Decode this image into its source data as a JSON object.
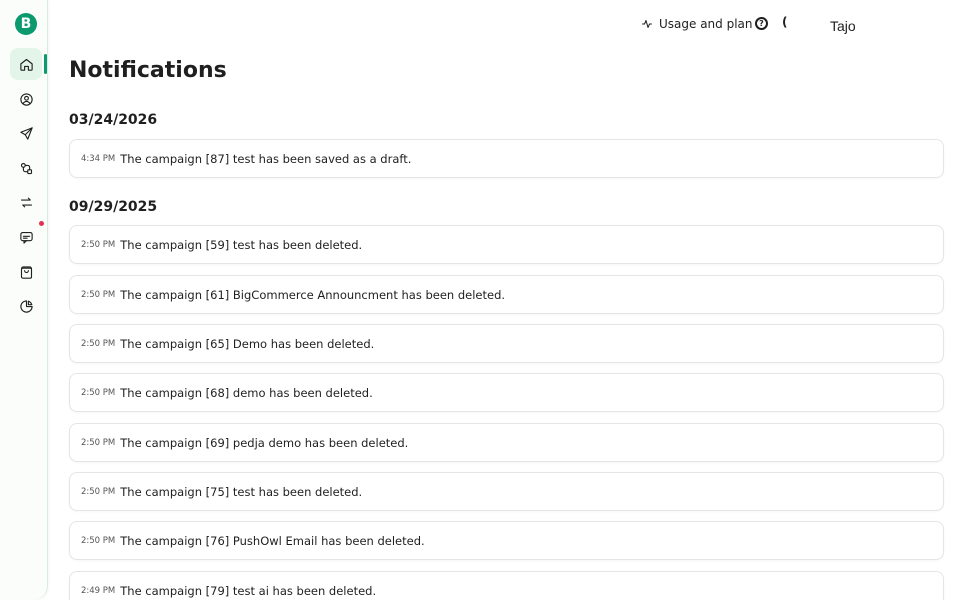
{
  "sidebar": {
    "logo_letter": "B",
    "items": [
      {
        "name": "home-icon"
      },
      {
        "name": "contacts-icon"
      },
      {
        "name": "send-icon"
      },
      {
        "name": "automation-icon"
      },
      {
        "name": "transactional-icon"
      },
      {
        "name": "conversations-icon"
      },
      {
        "name": "shop-icon"
      },
      {
        "name": "reports-icon"
      }
    ],
    "accent_color": "#0b996e",
    "badge_color": "#e0334d"
  },
  "header": {
    "usage_label": "Usage and plan",
    "help_glyph": "?",
    "partial_glyph": "(",
    "user_name": "Tajo"
  },
  "main": {
    "title": "Notifications",
    "groups": [
      {
        "date": "03/24/2026",
        "items": [
          {
            "time": "4:34 PM",
            "message": "The campaign [87] test has been saved as a draft."
          }
        ]
      },
      {
        "date": "09/29/2025",
        "items": [
          {
            "time": "2:50 PM",
            "message": "The campaign [59] test has been deleted."
          },
          {
            "time": "2:50 PM",
            "message": "The campaign [61] BigCommerce Announcment has been deleted."
          },
          {
            "time": "2:50 PM",
            "message": "The campaign [65] Demo has been deleted."
          },
          {
            "time": "2:50 PM",
            "message": "The campaign [68] demo has been deleted."
          },
          {
            "time": "2:50 PM",
            "message": "The campaign [69] pedja demo has been deleted."
          },
          {
            "time": "2:50 PM",
            "message": "The campaign [75] test has been deleted."
          },
          {
            "time": "2:50 PM",
            "message": "The campaign [76] PushOwl Email has been deleted."
          },
          {
            "time": "2:49 PM",
            "message": "The campaign [79] test ai has been deleted."
          }
        ]
      }
    ]
  }
}
